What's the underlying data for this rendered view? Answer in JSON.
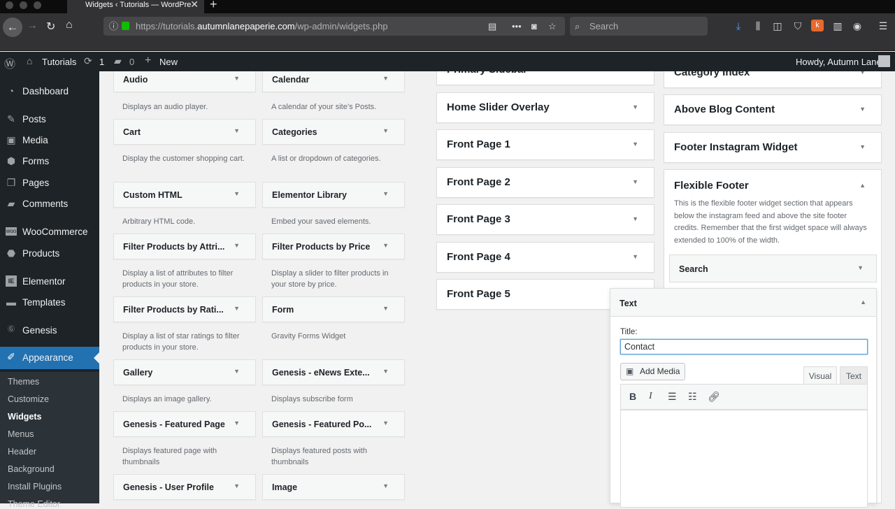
{
  "browser": {
    "tab_title": "Widgets ‹ Tutorials — WordPre",
    "url_prefix": "https://tutorials.",
    "url_domain": "autumnlanepaperie.com",
    "url_path": "/wp-admin/widgets.php",
    "search_placeholder": "Search"
  },
  "adminbar": {
    "site_name": "Tutorials",
    "updates_count": "1",
    "comments_count": "0",
    "new_label": "New",
    "greeting": "Howdy, Autumn Lane"
  },
  "sidebar": {
    "items": [
      {
        "label": "Dashboard",
        "icon": "dashboard-icon"
      },
      {
        "label": "Posts",
        "icon": "pin-icon"
      },
      {
        "label": "Media",
        "icon": "media-icon"
      },
      {
        "label": "Forms",
        "icon": "forms-icon"
      },
      {
        "label": "Pages",
        "icon": "pages-icon"
      },
      {
        "label": "Comments",
        "icon": "comment-icon"
      },
      {
        "label": "WooCommerce",
        "icon": "woo-icon"
      },
      {
        "label": "Products",
        "icon": "box-icon"
      },
      {
        "label": "Elementor",
        "icon": "elementor-icon"
      },
      {
        "label": "Templates",
        "icon": "folder-icon"
      },
      {
        "label": "Genesis",
        "icon": "genesis-icon"
      },
      {
        "label": "Appearance",
        "icon": "brush-icon"
      }
    ],
    "submenu": [
      "Themes",
      "Customize",
      "Widgets",
      "Menus",
      "Header",
      "Background",
      "Install Plugins",
      "Theme Editor"
    ],
    "active_submenu": "Widgets",
    "accent_color": "#2271b1"
  },
  "available_widgets": [
    {
      "title": "Audio",
      "desc": "Displays an audio player."
    },
    {
      "title": "Calendar",
      "desc": "A calendar of your site’s Posts."
    },
    {
      "title": "Cart",
      "desc": "Display the customer shopping cart."
    },
    {
      "title": "Categories",
      "desc": "A list or dropdown of categories."
    },
    {
      "title": "Custom HTML",
      "desc": "Arbitrary HTML code."
    },
    {
      "title": "Elementor Library",
      "desc": "Embed your saved elements."
    },
    {
      "title": "Filter Products by Attri...",
      "desc": "Display a list of attributes to filter products in your store."
    },
    {
      "title": "Filter Products by Price",
      "desc": "Display a slider to filter products in your store by price."
    },
    {
      "title": "Filter Products by Rati...",
      "desc": "Display a list of star ratings to filter products in your store."
    },
    {
      "title": "Form",
      "desc": "Gravity Forms Widget"
    },
    {
      "title": "Gallery",
      "desc": "Displays an image gallery."
    },
    {
      "title": "Genesis - eNews Exte...",
      "desc": "Displays subscribe form"
    },
    {
      "title": "Genesis - Featured Page",
      "desc": "Displays featured page with thumbnails"
    },
    {
      "title": "Genesis - Featured Po...",
      "desc": "Displays featured posts with thumbnails"
    },
    {
      "title": "Genesis - User Profile",
      "desc": ""
    },
    {
      "title": "Image",
      "desc": ""
    }
  ],
  "widget_areas_left": [
    "Primary Sidebar",
    "Home Slider Overlay",
    "Front Page 1",
    "Front Page 2",
    "Front Page 3",
    "Front Page 4",
    "Front Page 5"
  ],
  "widget_areas_right": [
    "Category Index",
    "Above Blog Content",
    "Footer Instagram Widget"
  ],
  "flexible_footer": {
    "title": "Flexible Footer",
    "description": "This is the flexible footer widget section that appears below the instagram feed and above the site footer credits. Remember that the first widget space will always extended to 100% of the width.",
    "widgets": [
      "Search"
    ]
  },
  "text_widget": {
    "header": "Text",
    "title_label": "Title:",
    "title_value": "Contact",
    "add_media_label": "Add Media",
    "tab_visual": "Visual",
    "tab_text": "Text",
    "toolbar": [
      "bold",
      "italic",
      "bulleted-list",
      "numbered-list",
      "link"
    ]
  }
}
